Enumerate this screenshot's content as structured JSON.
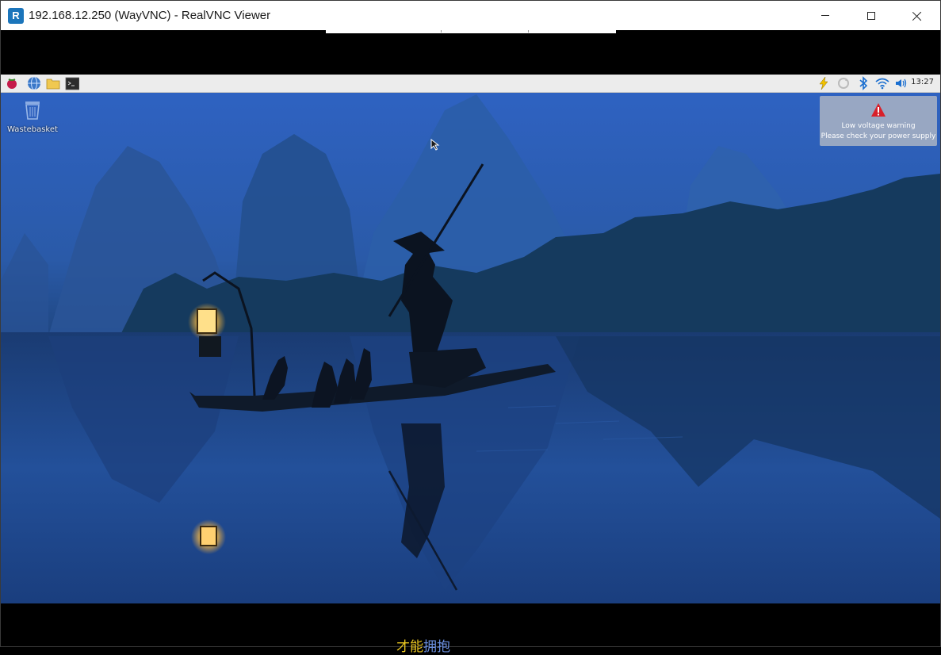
{
  "window": {
    "title": "192.168.12.250 (WayVNC) - RealVNC Viewer",
    "app_icon_letter": "R"
  },
  "remote": {
    "taskbar": {
      "left_icons": [
        "raspberry-menu-icon",
        "web-browser-icon",
        "file-manager-icon",
        "terminal-icon"
      ],
      "right_icons": [
        "lightning-icon",
        "sync-icon",
        "bluetooth-icon",
        "wifi-icon",
        "volume-icon"
      ],
      "clock": "13:27",
      "warning_color": "#f2c200"
    },
    "desktop": {
      "wastebasket_label": "Wastebasket",
      "notification": {
        "line1": "Low voltage warning",
        "line2": "Please check your power supply"
      }
    }
  },
  "bottom_overlay": {
    "part1": "才能",
    "part2": "拥抱"
  }
}
